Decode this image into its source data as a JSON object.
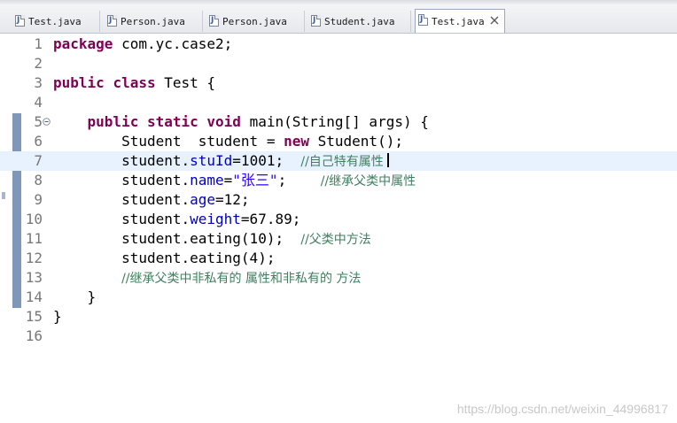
{
  "tabs": [
    {
      "label": "Test.java",
      "active": false
    },
    {
      "label": "Person.java",
      "active": false
    },
    {
      "label": "Person.java",
      "active": false
    },
    {
      "label": "Student.java",
      "active": false
    },
    {
      "label": "Test.java",
      "active": true
    }
  ],
  "editor": {
    "lines": [
      {
        "num": "1",
        "kw1": "package",
        "t1": " com.yc.case2;"
      },
      {
        "num": "2"
      },
      {
        "num": "3",
        "kw1": "public",
        "t1": " ",
        "kw2": "class",
        "t2": " Test {"
      },
      {
        "num": "4"
      },
      {
        "num": "5",
        "t0": "    ",
        "kw1": "public",
        "t1": " ",
        "kw2": "static",
        "t2": " ",
        "kw3": "void",
        "t3": " main(String[] args) {"
      },
      {
        "num": "6",
        "t0": "        Student  student = ",
        "kw1": "new",
        "t1": " Student();"
      },
      {
        "num": "7",
        "t0": "        student.",
        "field": "stuId",
        "t1": "=1001;  ",
        "comment": "//自己特有属性"
      },
      {
        "num": "8",
        "t0": "        student.",
        "field": "name",
        "t1": "=",
        "str": "\"张三\"",
        "t2": ";    ",
        "comment": "//继承父类中属性"
      },
      {
        "num": "9",
        "t0": "        student.",
        "field": "age",
        "t1": "=12;"
      },
      {
        "num": "10",
        "t0": "        student.",
        "field": "weight",
        "t1": "=67.89;"
      },
      {
        "num": "11",
        "t0": "        student.eating(10);  ",
        "comment": "//父类中方法"
      },
      {
        "num": "12",
        "t0": "        student.eating(4);"
      },
      {
        "num": "13",
        "t0": "        ",
        "comment": "//继承父类中非私有的 属性和非私有的 方法"
      },
      {
        "num": "14",
        "t0": "    }"
      },
      {
        "num": "15",
        "t0": "}"
      },
      {
        "num": "16"
      }
    ],
    "current_line": 7
  },
  "watermark": "https://blog.csdn.net/weixin_44996817",
  "colors": {
    "keyword": "#7f0055",
    "field": "#0000c0",
    "string": "#2a00ff",
    "comment": "#3f7f5f",
    "current_line_bg": "#e8f2fe"
  },
  "icons": {
    "tab_file": "java-file-icon",
    "tab_close": "close-icon",
    "fold": "collapse-toggle-icon"
  }
}
